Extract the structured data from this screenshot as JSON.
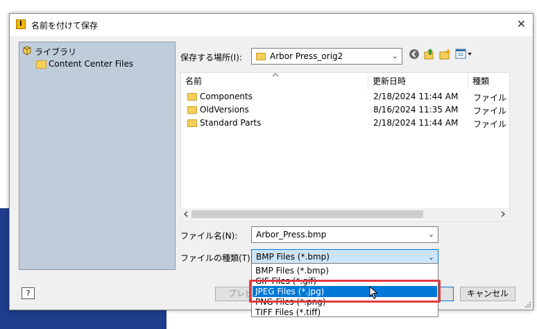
{
  "dialog": {
    "title": "名前を付けて保存",
    "title_icon": "I",
    "close": "✕"
  },
  "library": {
    "root": "ライブラリ",
    "child": "Content Center Files"
  },
  "location": {
    "label": "保存する場所(I):",
    "value": "Arbor Press_orig2"
  },
  "columns": {
    "name": "名前",
    "modified": "更新日時",
    "type": "種類"
  },
  "files": [
    {
      "name": "Components",
      "modified": "2/18/2024 11:44 AM",
      "type": "ファイル フォ"
    },
    {
      "name": "OldVersions",
      "modified": "8/16/2024 11:35 AM",
      "type": "ファイル フォ"
    },
    {
      "name": "Standard Parts",
      "modified": "2/18/2024 11:44 AM",
      "type": "ファイル フォ"
    }
  ],
  "filename": {
    "label": "ファイル名(N):",
    "value": "Arbor_Press.bmp"
  },
  "filetype": {
    "label": "ファイルの種類(T):",
    "value": "BMP Files (*.bmp)",
    "options": [
      "BMP Files (*.bmp)",
      "GIF Files (*.gif)",
      "JPEG Files (*.jpg)",
      "PNG Files (*.png)",
      "TIFF Files (*.tiff)"
    ],
    "selected_option": "JPEG Files (*.jpg)"
  },
  "buttons": {
    "help": "?",
    "preview": "プレビ",
    "cancel": "キャンセル"
  },
  "colors": {
    "selection": "#0078d7",
    "highlight_box": "#e0393e",
    "library_panel": "#bfcddb"
  },
  "icons": [
    "back-icon",
    "up-folder-icon",
    "new-folder-icon",
    "view-menu-icon"
  ]
}
